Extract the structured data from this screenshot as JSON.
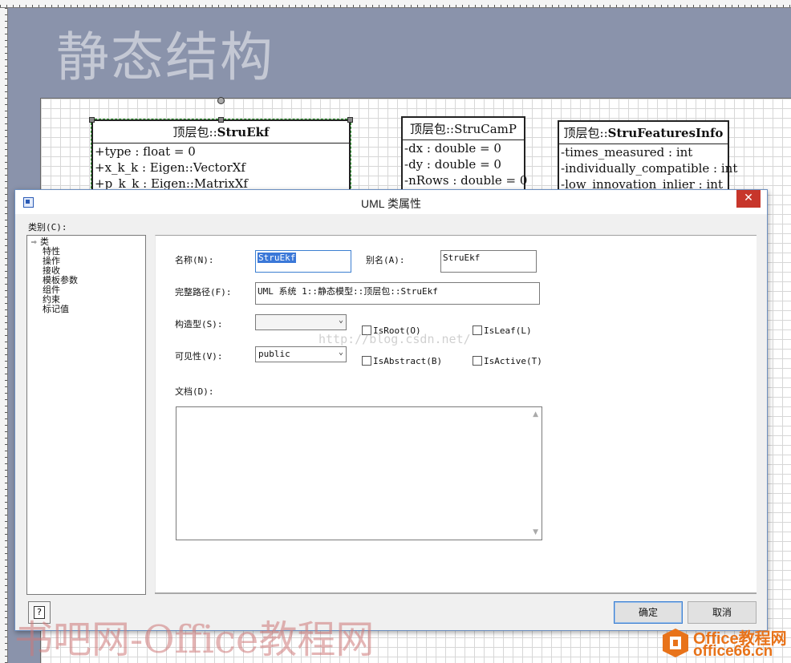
{
  "canvas": {
    "title": "静态结构",
    "classes": [
      {
        "header_prefix": "顶层包::",
        "header_name": "StruEkf",
        "attributes": [
          "+type : float = 0",
          "+x_k_k : Eigen::VectorXf",
          "+p_k_k : Eigen::MatrixXf"
        ]
      },
      {
        "header_prefix": "顶层包::",
        "header_name": "StruCamP",
        "attributes": [
          "-dx : double = 0",
          "-dy : double = 0",
          "-nRows : double = 0"
        ]
      },
      {
        "header_prefix": "顶层包::",
        "header_name": "StruFeaturesInfo",
        "attributes": [
          "-times_measured  : int",
          "-individually_compatible : int",
          "-low_innovation_inlier : int"
        ]
      }
    ]
  },
  "dialog": {
    "title": "UML 类属性",
    "close_glyph": "✕",
    "category_label": "类别(C):",
    "categories": [
      "类",
      "特性",
      "操作",
      "接收",
      "模板参数",
      "组件",
      "约束",
      "标记值"
    ],
    "selected_category_arrow": "⇨",
    "fields": {
      "name_label": "名称(N):",
      "name_value": "StruEkf",
      "alias_label": "别名(A):",
      "alias_value": "StruEkf",
      "fullpath_label": "完整路径(F):",
      "fullpath_value": "UML 系统 1::静态模型::顶层包::StruEkf",
      "stereotype_label": "构造型(S):",
      "stereotype_value": "",
      "visibility_label": "可见性(V):",
      "visibility_value": "public",
      "doc_label": "文档(D):",
      "doc_value": ""
    },
    "checkboxes": {
      "is_root": "IsRoot(O)",
      "is_leaf": "IsLeaf(L)",
      "is_abstract": "IsAbstract(B)",
      "is_active": "IsActive(T)"
    },
    "buttons": {
      "help": "?",
      "ok": "确定",
      "cancel": "取消"
    }
  },
  "watermarks": {
    "url": "http://blog.csdn.net/",
    "left": "书吧网-Office教程网",
    "brand_top": "Office教程网",
    "brand_bottom": "office66.cn"
  },
  "colors": {
    "canvas_bg": "#8a93ab",
    "close_red": "#c7362b",
    "brand_orange": "#e8731a",
    "selection_green": "#2aa02a"
  }
}
